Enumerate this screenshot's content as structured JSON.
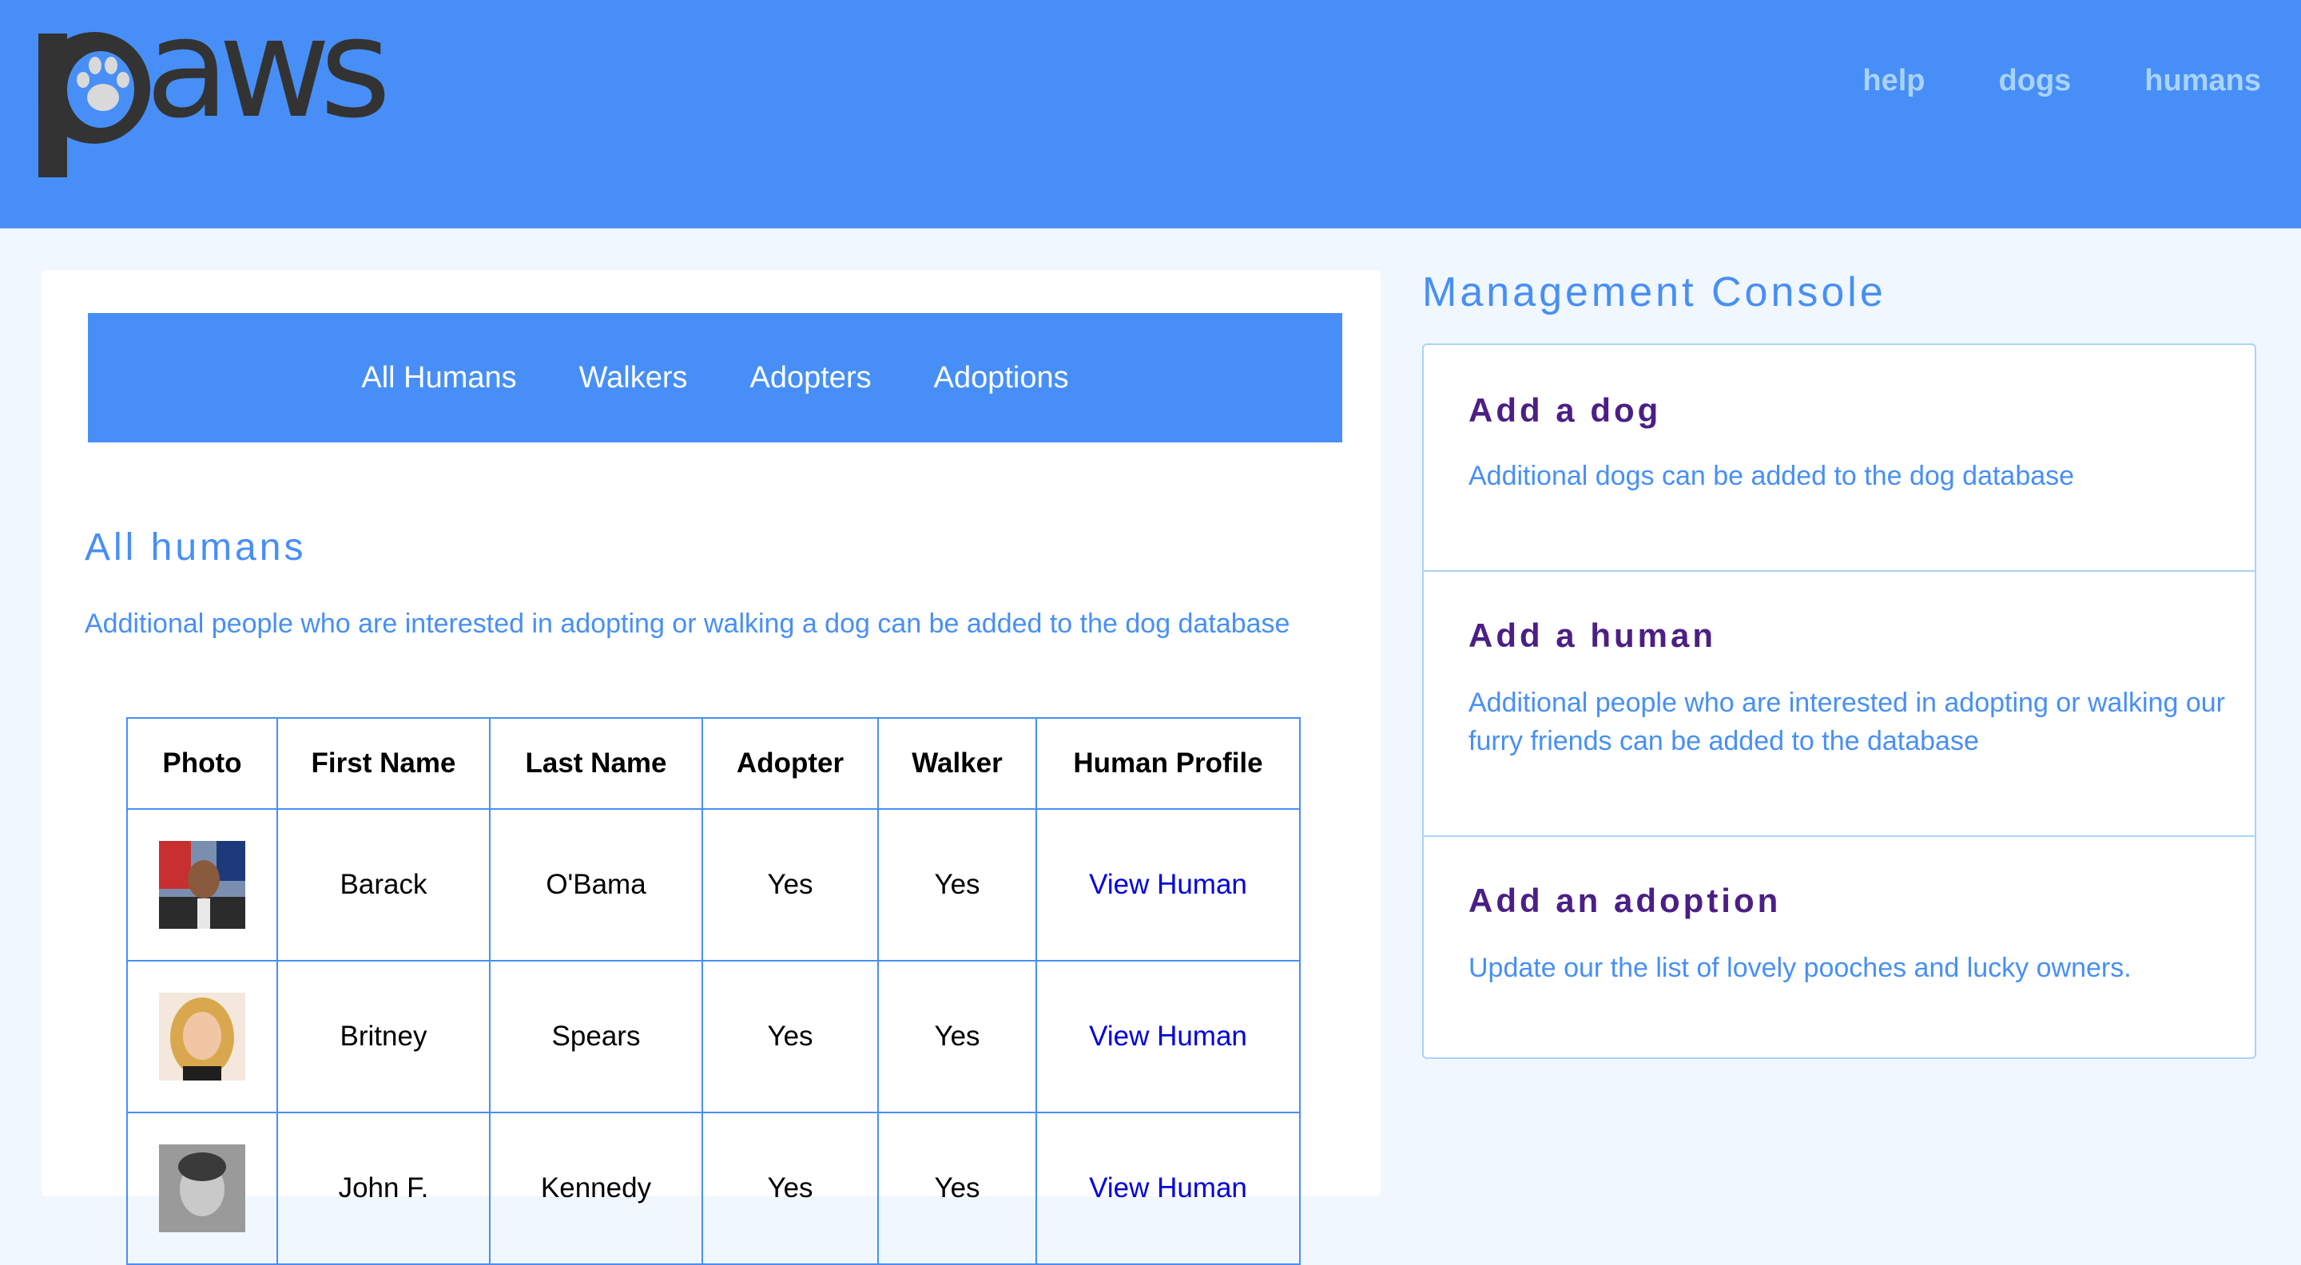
{
  "header": {
    "logo_text": "paws",
    "nav": [
      "help",
      "dogs",
      "humans"
    ]
  },
  "subnav": [
    "All Humans",
    "Walkers",
    "Adopters",
    "Adoptions"
  ],
  "section": {
    "title": "All humans",
    "description": "Additional people who are interested in adopting or walking a dog can be added to the dog database"
  },
  "table": {
    "headers": [
      "Photo",
      "First Name",
      "Last Name",
      "Adopter",
      "Walker",
      "Human Profile"
    ],
    "rows": [
      {
        "first": "Barack",
        "last": "O'Bama",
        "adopter": "Yes",
        "walker": "Yes",
        "link": "View Human"
      },
      {
        "first": "Britney",
        "last": "Spears",
        "adopter": "Yes",
        "walker": "Yes",
        "link": "View Human"
      },
      {
        "first": "John F.",
        "last": "Kennedy",
        "adopter": "Yes",
        "walker": "Yes",
        "link": "View Human"
      }
    ]
  },
  "console": {
    "title": "Management Console",
    "items": [
      {
        "title": "Add a dog",
        "desc": "Additional dogs can be added to the dog database"
      },
      {
        "title": "Add a human",
        "desc": "Additional people who are interested in adopting or walking our furry friends can be added to the database"
      },
      {
        "title": "Add an adoption",
        "desc": "Update our the list of lovely pooches and lucky owners."
      }
    ]
  },
  "colors": {
    "brand_blue": "#478ff7",
    "page_bg": "#f1f7fe",
    "heading_purple": "#4b1f86",
    "link_blue": "#0000dd",
    "nav_light": "#a9d3fa",
    "logo_dark": "#333333"
  }
}
